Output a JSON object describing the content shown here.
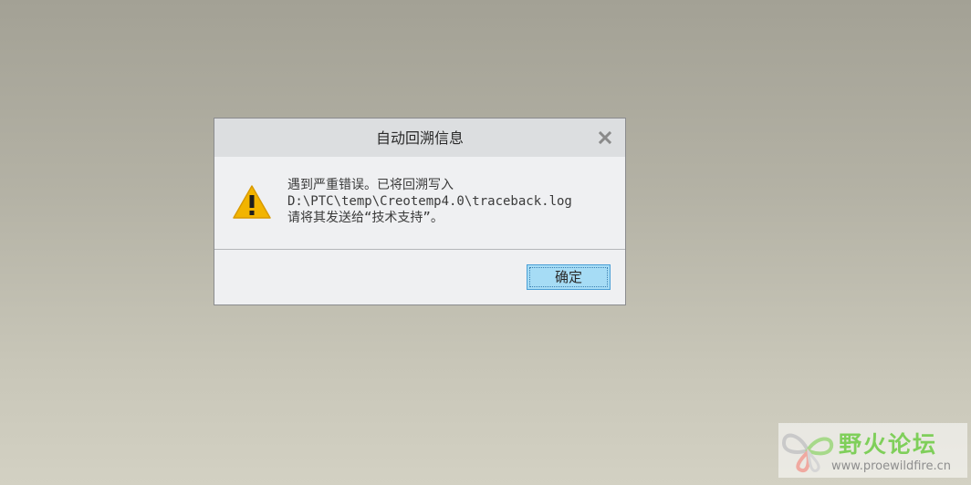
{
  "dialog": {
    "title": "自动回溯信息",
    "close_icon": "close-icon",
    "warning_icon": "warning-icon",
    "message_lines": [
      "遇到严重错误。已将回溯写入",
      "D:\\PTC\\temp\\Creotemp4.0\\traceback.log",
      "请将其发送给“技术支持”。"
    ],
    "ok_label": "确定"
  },
  "watermark": {
    "name": "野火论坛",
    "url": "www.proewildfire.cn",
    "logo_icon": "butterfly-logo"
  },
  "colors": {
    "titlebar": "#dcdee0",
    "dialog_bg": "#eff0f2",
    "button_bg": "#a6dcf5",
    "warning": "#f2b400",
    "watermark_text": "#7fcf5a"
  }
}
